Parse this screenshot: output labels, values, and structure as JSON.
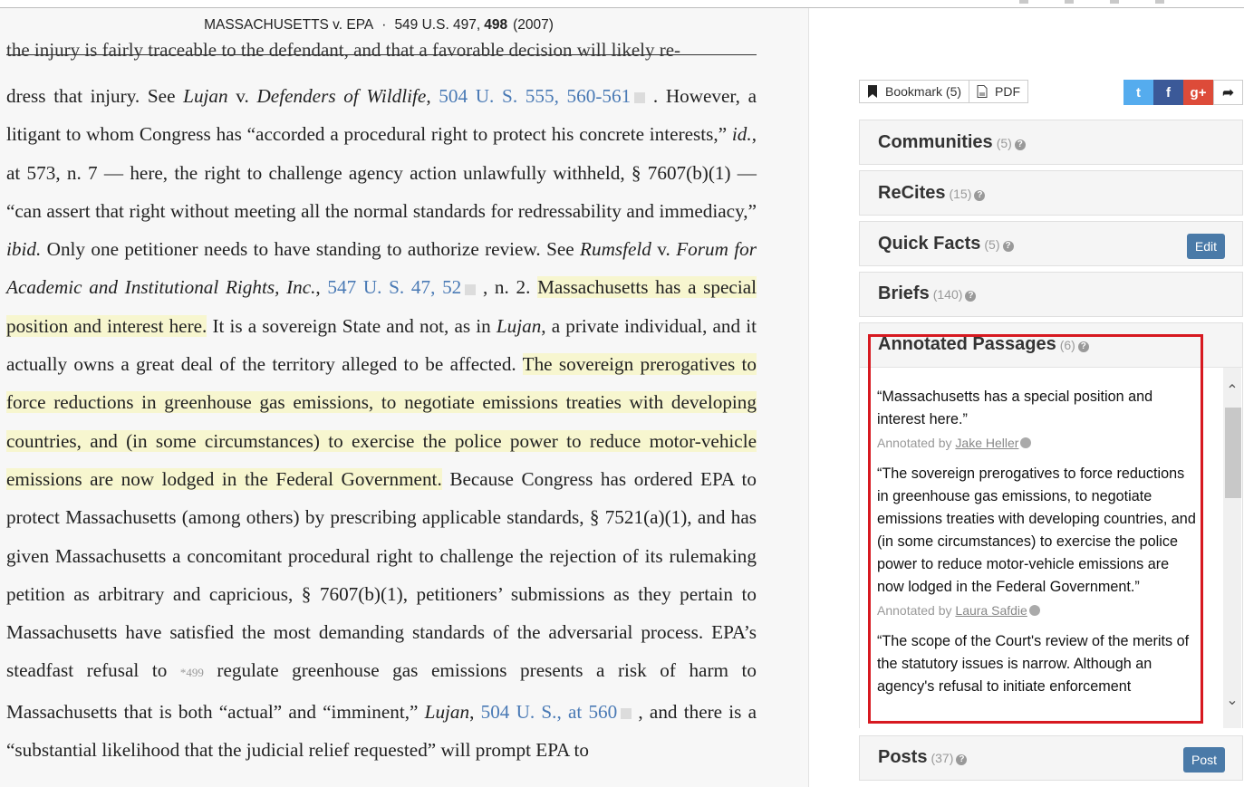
{
  "header": {
    "case_name": "MASSACHUSETTS v. EPA",
    "separator": "·",
    "citation": "549 U.S. 497,",
    "page": "498",
    "year": "(2007)"
  },
  "opinion": {
    "ghost_line": "the injury is fairly traceable to the defendant, and that a favorable decision will likely re-",
    "p1": "dress that injury. See ",
    "p1_i1": "Lujan",
    "p1_v": " v. ",
    "p1_i2": "Defenders of Wildlife",
    "p1_comma": ", ",
    "p1_link": "504 U. S. 555, 560-561",
    "p2": " . However, a litigant to whom Congress has “accorded a procedural right to protect his concrete interests,” ",
    "p2_i": "id.",
    "p3": ", at 573, n. 7 — here, the right to challenge agency action unlawfully withheld, § 7607(b)(1) — “can assert that right without meeting all the normal standards for redressability and immediacy,” ",
    "p3_i": "ibid.",
    "p4": " Only one petitioner needs to have standing to authorize review. See ",
    "p4_i1": "Rumsfeld",
    "p4_v": " v. ",
    "p4_i2": "Forum for Academic and Institutional Rights, Inc.",
    "p4_comma": ", ",
    "p4_link": "547 U. S. 47, 52",
    "p5": " , n. 2. ",
    "hl1": "Massachusetts has a special position and interest here.",
    "p6": " It is a sovereign State and not, as in ",
    "p6_i": "Lujan",
    "p7": ", a private individual, and it actually owns a great deal of the territory alleged to be affected. ",
    "hl2": "The sovereign prerogatives to force reductions in greenhouse gas emissions, to negotiate emissions treaties with developing countries, and (in some circumstances) to exercise the police power to reduce motor-vehicle emissions are now lodged in the Federal Government.",
    "p8": " Because Congress has ordered EPA to protect Massachusetts (among others) by prescribing applicable standards, § 7521(a)(1), and has given Massachusetts a concomitant procedural right to challenge the rejection of its rulemaking petition as arbitrary and capricious, § 7607(b)(1), petitioners’ submissions as they pertain to Massachusetts have satisfied the most demanding standards of the adversarial process. EPA’s steadfast refusal to ",
    "page_marker": "*499",
    "p9": " regulate greenhouse gas emissions presents a risk of harm to Massachusetts that is both “actual” and “imminent,” ",
    "p9_i": "Lujan",
    "p9_comma": ", ",
    "p9_link": "504 U. S., at 560",
    "p10": " , and there is a “substantial likelihood that the judicial relief requested” will prompt EPA to"
  },
  "toolbar": {
    "bookmark_label": "Bookmark (5)",
    "pdf_label": "PDF"
  },
  "social": {
    "twitter": "t",
    "facebook": "f",
    "gplus": "g+",
    "share": "➦"
  },
  "panels": {
    "communities": {
      "title": "Communities",
      "count": "(5)"
    },
    "recites": {
      "title": "ReCites",
      "count": "(15)"
    },
    "quick_facts": {
      "title": "Quick Facts",
      "count": "(5)",
      "button": "Edit"
    },
    "briefs": {
      "title": "Briefs",
      "count": "(140)"
    },
    "annotated": {
      "title": "Annotated Passages",
      "count": "(6)"
    },
    "posts": {
      "title": "Posts",
      "count": "(37)",
      "button": "Post"
    }
  },
  "annotations": [
    {
      "quote": "“Massachusetts has a special position and interest here.”",
      "by_label": "Annotated by",
      "author": "Jake Heller"
    },
    {
      "quote": "“The sovereign prerogatives to force reductions in greenhouse gas emissions, to negotiate emissions treaties with developing countries, and (in some circumstances) to exercise the police power to reduce motor-vehicle emissions are now lodged in the Federal Government.”",
      "by_label": "Annotated by",
      "author": "Laura Safdie"
    },
    {
      "quote": "“The scope of the Court's review of the merits of the statutory issues is narrow. Although an agency's refusal to initiate enforcement"
    }
  ],
  "colors": {
    "highlight": "#f7f6cf",
    "link": "#4a7ab5",
    "twitter": "#55acee",
    "facebook": "#3b5998",
    "gplus": "#dd4b39",
    "button": "#4a7aa8",
    "callout": "#d71920"
  },
  "icons": [
    "bookmark-icon",
    "pdf-icon",
    "twitter-icon",
    "facebook-icon",
    "google-plus-icon",
    "share-icon",
    "help-icon",
    "verified-icon",
    "scroll-up-icon",
    "scroll-down-icon"
  ]
}
